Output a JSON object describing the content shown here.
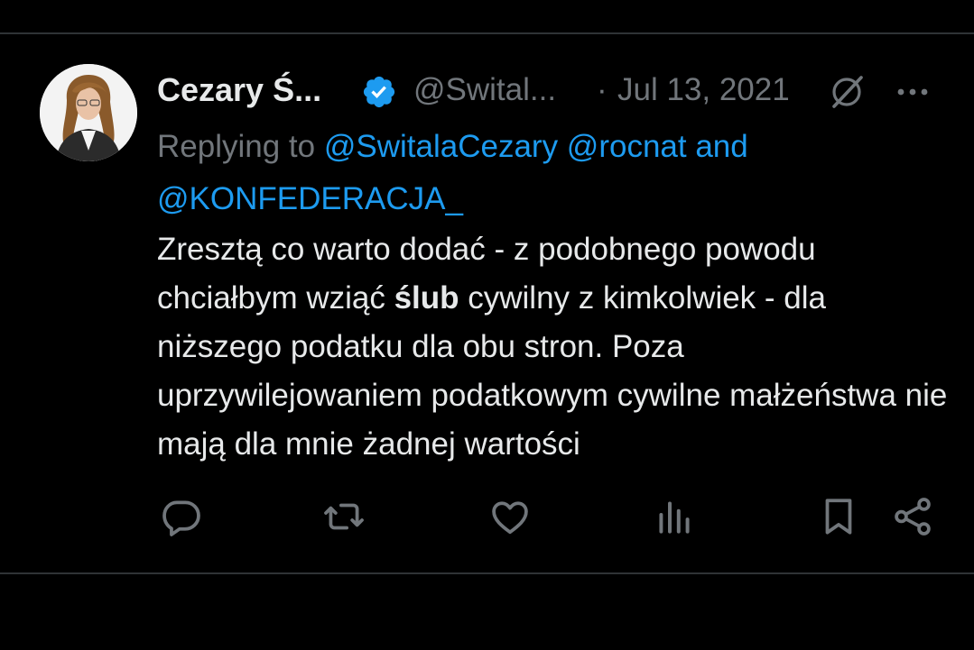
{
  "tweet": {
    "display_name": "Cezary Ś...",
    "handle": "@Swital...",
    "separator": "·",
    "date": "Jul 13, 2021",
    "replying_prefix": "Replying to",
    "mentions": [
      "@SwitalaCezary",
      "@rocnat"
    ],
    "mention_conjunction": "and",
    "mention_last": "@KONFEDERACJA_",
    "body_before_bold": "Zresztą co warto dodać - z podobnego powodu chciałbym wziąć ",
    "body_bold": "ślub",
    "body_after_bold": " cywilny z kimkolwiek - dla niższego podatku dla obu stron. Poza uprzywilejowaniem podatkowym cywilne małżeństwa nie mają dla mnie żadnej wartości"
  },
  "icons": {
    "verified": "verified-badge-icon",
    "grok": "grok-icon",
    "more": "more-icon",
    "reply": "reply-icon",
    "retweet": "retweet-icon",
    "like": "like-icon",
    "views": "views-icon",
    "bookmark": "bookmark-icon",
    "share": "share-icon"
  },
  "colors": {
    "background": "#000000",
    "text": "#e7e9ea",
    "muted": "#71767b",
    "accent": "#1d9bf0",
    "divider": "#2f3336"
  }
}
